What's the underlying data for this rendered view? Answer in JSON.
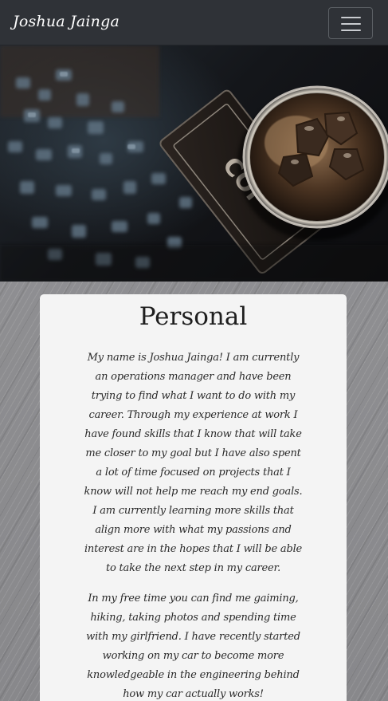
{
  "navbar": {
    "brand": "Joshua Jainga",
    "toggle_icon": "hamburger-menu-icon"
  },
  "hero": {
    "image": "coffee-glass-and-puzzle-pieces-photo"
  },
  "personal": {
    "title": "Personal",
    "paragraphs": [
      "My name is Joshua Jainga! I am currently an operations manager and have been trying to find what I want to do with my career. Through my experience at work I have found skills that I know that will take me closer to my goal but I have also spent a lot of time focused on projects that I know will not help me reach my end goals. I am currently learning more skills that align more with what my passions and interest are in the hopes that I will be able to take the next step in my career.",
      "In my free time you can find me gaiming, hiking, taking photos and spending time with my girlfriend. I have recently started working on my car to become more knowledgeable in the engineering behind how my car actually works!"
    ]
  },
  "colors": {
    "navbar_bg": "#2f3237",
    "card_bg": "#f4f4f4",
    "page_bg": "#8d8d8f"
  }
}
